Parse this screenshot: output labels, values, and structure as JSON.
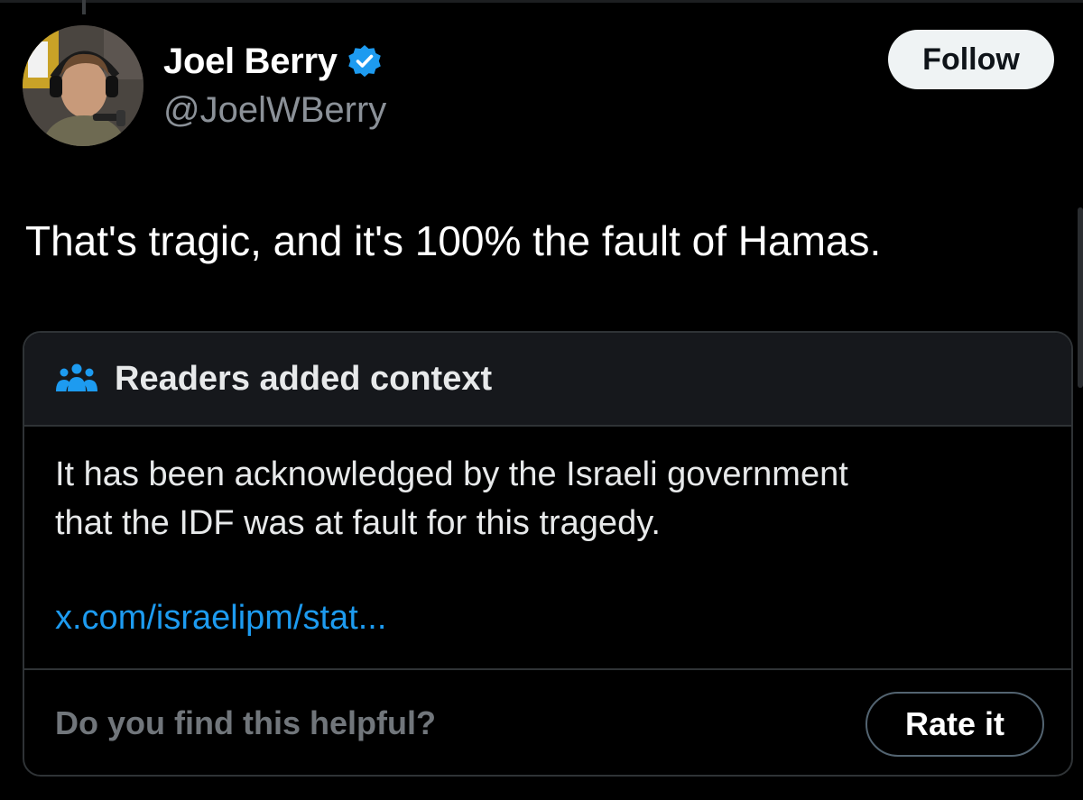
{
  "author": {
    "display_name": "Joel Berry",
    "handle": "@JoelWBerry",
    "verified": true,
    "avatar_icon": "profile-photo"
  },
  "follow_button": {
    "label": "Follow"
  },
  "tweet": {
    "text": "That's tragic, and it's 100% the fault of Hamas."
  },
  "community_note": {
    "header_icon": "people-icon",
    "title": "Readers added context",
    "body_lines": [
      "It has been acknowledged by the Israeli government",
      "that the IDF was at fault for this tragedy."
    ],
    "link": "x.com/israelipm/stat...",
    "helpful_prompt": "Do you find this helpful?",
    "rate_label": "Rate it"
  },
  "colors": {
    "background": "#000000",
    "link": "#1d9bf0",
    "verified": "#1d9bf0",
    "border": "#2f3336",
    "muted": "#71767b"
  }
}
